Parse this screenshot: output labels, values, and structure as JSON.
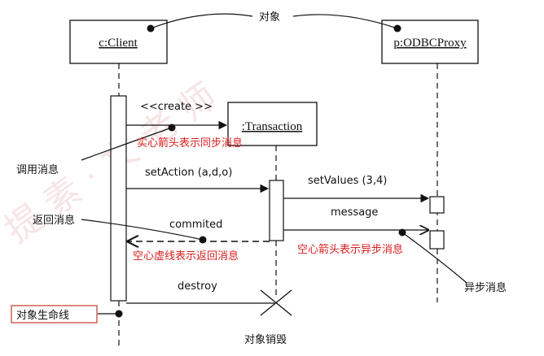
{
  "watermark": "提 素 · 文 老 师",
  "objects": {
    "client": "c:Client",
    "proxy": "p:ODBCProxy",
    "transaction": ":Transaction"
  },
  "messages": {
    "create": "<<create >>",
    "set_action": "setAction (a,d,o)",
    "set_values": "setValues (3,4)",
    "message": "message",
    "commited": "commited",
    "destroy": "destroy"
  },
  "annotations": {
    "object": "对象",
    "call_message": "调用消息",
    "return_message": "返回消息",
    "async_message": "异步消息",
    "destroy_object": "对象销毁",
    "lifeline": "对象生命线"
  },
  "red_notes": {
    "sync_arrow": "实心箭头表示同步消息",
    "dashed_return": "空心虚线表示返回消息",
    "async_arrow": "空心箭头表示异步消息"
  },
  "colors": {
    "ink": "#111111",
    "note_red": "#d81f1f",
    "lifeline_box_border": "#c0392b",
    "watermark": "#f3d6d6"
  }
}
